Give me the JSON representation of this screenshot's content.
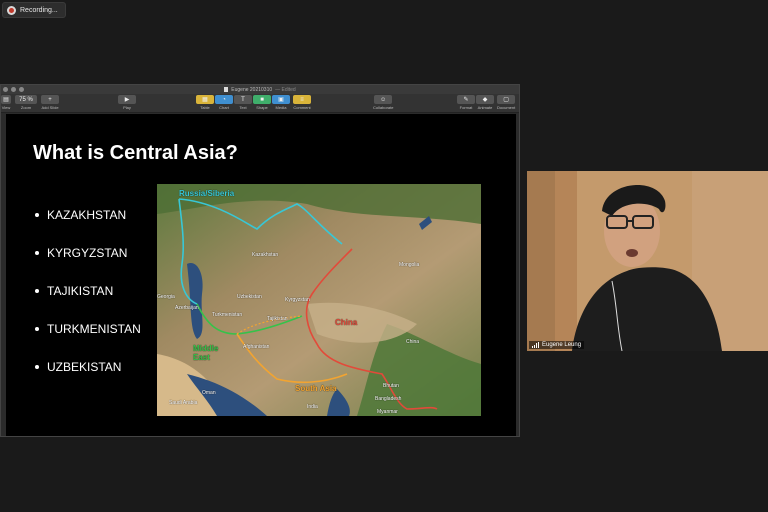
{
  "recording": {
    "label": "Recording...",
    "icon": "record-icon"
  },
  "keynote": {
    "window_title": "Eugene 20210310",
    "edited": "— Edited",
    "toolbar": {
      "view": "View",
      "zoom_value": "75 %",
      "zoom": "Zoom",
      "add_slide": "Add Slide",
      "play": "Play",
      "table": "Table",
      "chart": "Chart",
      "text": "Text",
      "shape": "Shape",
      "media": "Media",
      "comment": "Comment",
      "collaborate": "Collaborate",
      "format": "Format",
      "animate": "Animate",
      "document": "Document"
    }
  },
  "slide": {
    "title": "What is Central Asia?",
    "bullets": [
      "KAZAKHSTAN",
      "KYRGYZSTAN",
      "TAJIKISTAN",
      "TURKMENISTAN",
      "UZBEKISTAN"
    ],
    "map": {
      "russia": "Russia/Siberia",
      "china": "China",
      "middle_east": "Middle East",
      "south_asia": "South Asia",
      "kazakhstan": "Kazakhstan",
      "mongolia": "Mongolia",
      "uzbekistan": "Uzbekistan",
      "kyrgyzstan": "Kyrgyzstan",
      "turkmenistan": "Turkmenistan",
      "tajikistan": "Tajikistan",
      "azerbaijan": "Azerbaijan",
      "georgia": "Georgia",
      "afghanistan": "Afghanistan",
      "china_small": "China",
      "india": "India",
      "bangladesh": "Bangladesh",
      "myanmar": "Myanmar",
      "bhutan": "Bhutan",
      "saudi": "Saudi Arabia",
      "oman": "Oman"
    }
  },
  "participant": {
    "name": "Eugene Leung"
  },
  "colors": {
    "accent_cyan": "#38c7d6",
    "accent_red": "#e24a3a",
    "accent_green": "#36c24a",
    "accent_orange": "#f2a431"
  }
}
